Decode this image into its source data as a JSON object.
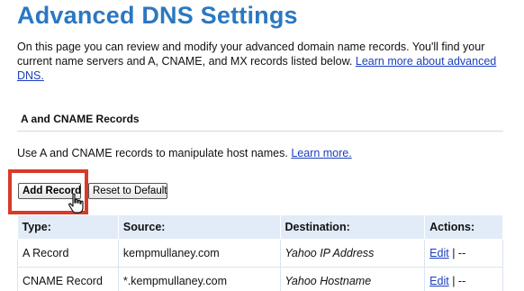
{
  "page": {
    "title": "Advanced DNS Settings",
    "intro_text": "On this page you can review and modify your advanced domain name records. You'll find your current name servers and A, CNAME, and MX records listed below.",
    "intro_link": "Learn more about advanced DNS."
  },
  "a_cname_section": {
    "heading": "A and CNAME Records",
    "intro_text": "Use A and CNAME records to manipulate host names.",
    "intro_link": "Learn more.",
    "add_button": "Add Record",
    "reset_button": "Reset to Default",
    "table": {
      "headers": [
        "Type:",
        "Source:",
        "Destination:",
        "Actions:"
      ],
      "rows": [
        {
          "type": "A Record",
          "source": "kempmullaney.com",
          "destination": "Yahoo IP Address",
          "edit": "Edit",
          "separator": "| --"
        },
        {
          "type": "CNAME Record",
          "source": "*.kempmullaney.com",
          "destination": "Yahoo Hostname",
          "edit": "Edit",
          "separator": "| --"
        }
      ]
    }
  },
  "colors": {
    "title": "#2b78c1",
    "link": "#1b3fbe",
    "highlight": "#d83a2a",
    "table_header_bg": "#e2ecf8"
  },
  "icons": {
    "cursor": "hand-pointer-icon"
  }
}
